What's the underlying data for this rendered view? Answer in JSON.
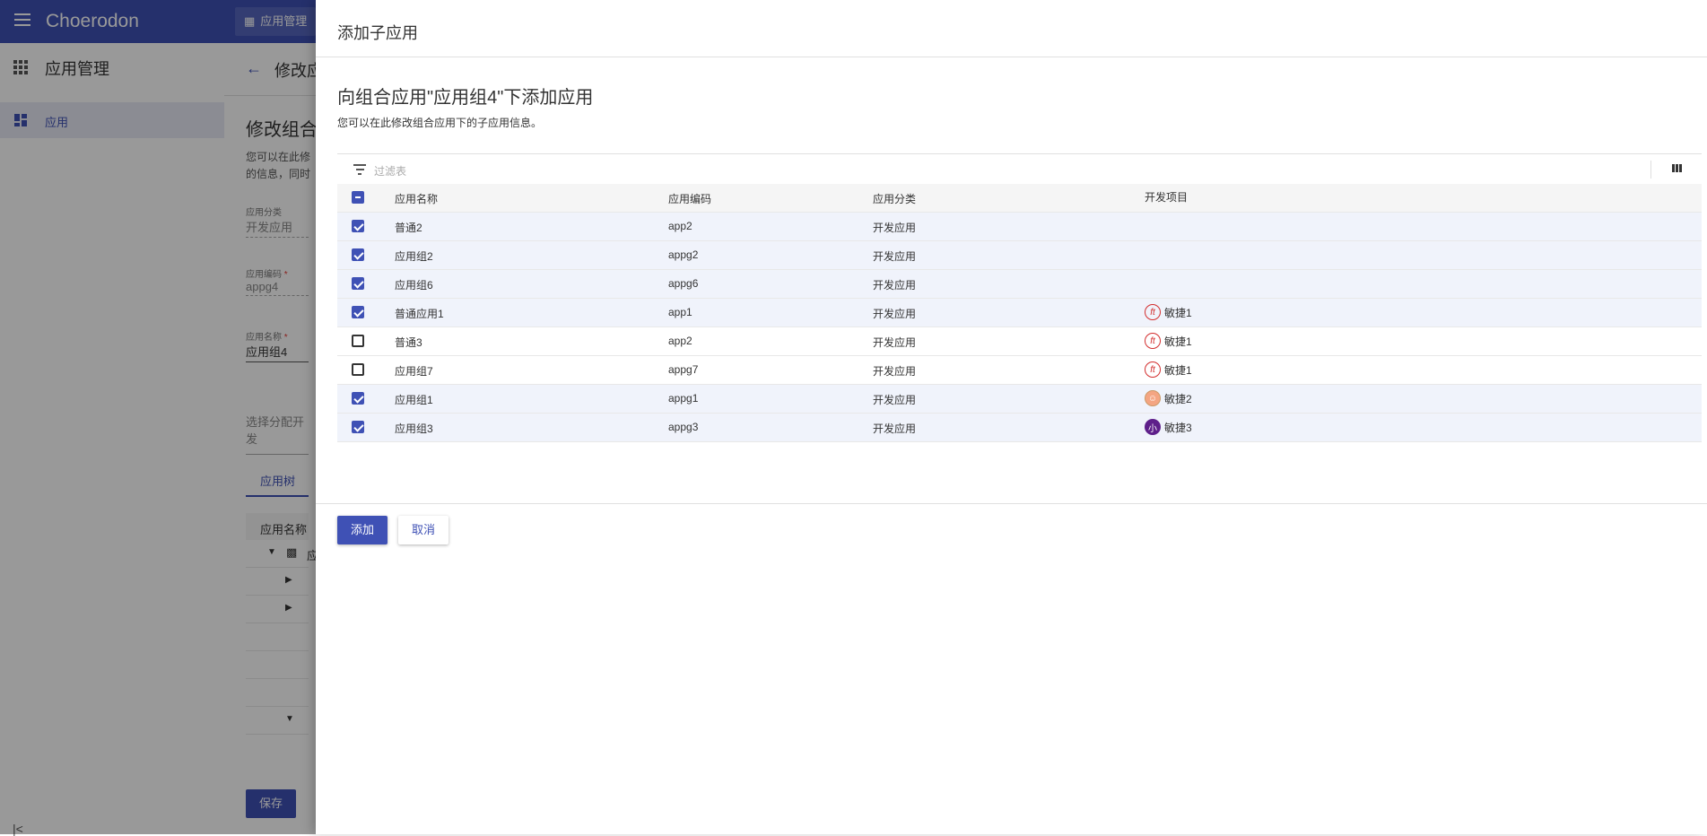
{
  "app": {
    "brand": "Choerodon",
    "top_button": "应用管理"
  },
  "sidebar": {
    "title": "应用管理",
    "items": [
      {
        "label": "应用"
      }
    ]
  },
  "main": {
    "header_title": "修改应",
    "heading": "修改组合",
    "desc_line1": "您可以在此修",
    "desc_line2": "的信息，同时",
    "fields": [
      {
        "label": "应用分类",
        "value": "开发应用"
      },
      {
        "label": "应用编码",
        "value": "appg4",
        "required": true
      },
      {
        "label": "应用名称",
        "value": "应用组4",
        "required": true
      }
    ],
    "select_placeholder": "选择分配开发",
    "tab": "应用树",
    "tree_header": "应用名称",
    "tree_first_row": "应",
    "save": "保存"
  },
  "modal": {
    "title": "添加子应用",
    "heading": "向组合应用\"应用组4\"下添加应用",
    "description": "您可以在此修改组合应用下的子应用信息。",
    "filter_placeholder": "过滤表",
    "columns": [
      "应用名称",
      "应用编码",
      "应用分类",
      "开发项目"
    ],
    "rows": [
      {
        "checked": true,
        "name": "普通2",
        "code": "app2",
        "category": "开发应用",
        "project": "",
        "avatar": ""
      },
      {
        "checked": true,
        "name": "应用组2",
        "code": "appg2",
        "category": "开发应用",
        "project": "",
        "avatar": ""
      },
      {
        "checked": true,
        "name": "应用组6",
        "code": "appg6",
        "category": "开发应用",
        "project": "",
        "avatar": ""
      },
      {
        "checked": true,
        "name": "普通应用1",
        "code": "app1",
        "category": "开发应用",
        "project": "敏捷1",
        "avatar": "logo-red"
      },
      {
        "checked": false,
        "name": "普通3",
        "code": "app2",
        "category": "开发应用",
        "project": "敏捷1",
        "avatar": "logo-red"
      },
      {
        "checked": false,
        "name": "应用组7",
        "code": "appg7",
        "category": "开发应用",
        "project": "敏捷1",
        "avatar": "logo-red"
      },
      {
        "checked": true,
        "name": "应用组1",
        "code": "appg1",
        "category": "开发应用",
        "project": "敏捷2",
        "avatar": "face-orange"
      },
      {
        "checked": true,
        "name": "应用组3",
        "code": "appg3",
        "category": "开发应用",
        "project": "敏捷3",
        "avatar": "logo-purple"
      }
    ],
    "add_label": "添加",
    "cancel_label": "取消"
  },
  "colors": {
    "primary": "#3f51b5",
    "overlay": "rgba(0,0,0,0.4)",
    "checked_row": "#f0f3fb"
  }
}
